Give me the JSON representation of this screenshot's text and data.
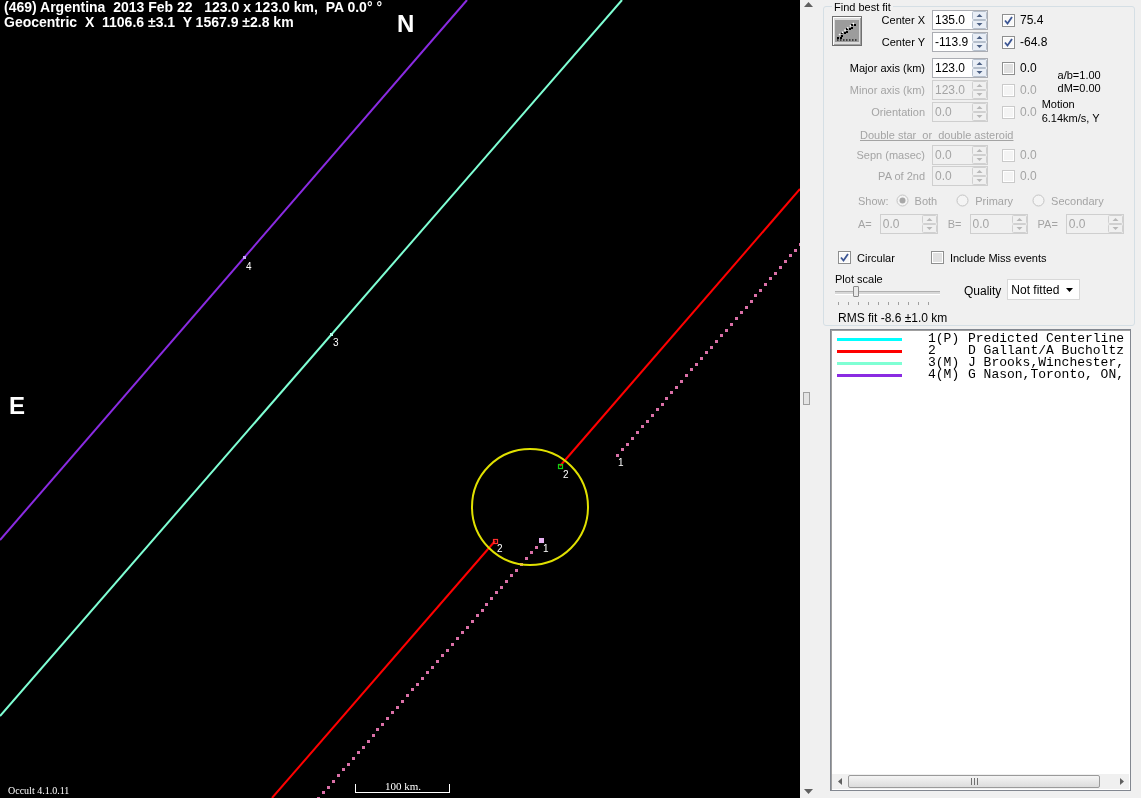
{
  "plot": {
    "title": "(469) Argentina  2013 Feb 22   123.0 x 123.0 km,  PA 0.0° °",
    "subtitle": "Geocentric  X  1106.6 ±3.1  Y 1567.9 ±2.8 km",
    "north": "N",
    "east": "E",
    "version": "Occult 4.1.0.11",
    "scale_bar": "100 km.",
    "chords": [
      {
        "color": "#8a2be2",
        "kind": "solid",
        "labels": [
          "4"
        ]
      },
      {
        "color": "#7fffd4",
        "kind": "solid",
        "labels": [
          "3"
        ]
      },
      {
        "color": "#ff0000",
        "kind": "solid",
        "labels": [
          "2",
          "2"
        ]
      },
      {
        "color": "#db70a8",
        "kind": "dotted",
        "labels": [
          "1",
          "1"
        ]
      }
    ]
  },
  "fit_panel": {
    "title": "Find best fit",
    "params": [
      {
        "label": "Center X",
        "value": "135.0",
        "checked": true,
        "result": "75.4",
        "disabled": false
      },
      {
        "label": "Center Y",
        "value": "-113.9",
        "checked": true,
        "result": "-64.8",
        "disabled": false
      },
      {
        "label": "Major axis (km)",
        "value": "123.0",
        "checked": false,
        "result": "0.0",
        "disabled": false
      },
      {
        "label": "Minor axis (km)",
        "value": "123.0",
        "checked": false,
        "result": "0.0",
        "disabled": true
      },
      {
        "label": "Orientation",
        "value": "0.0",
        "checked": false,
        "result": "0.0",
        "disabled": true
      }
    ],
    "ratio": "a/b=1.00",
    "dm": "dM=0.00",
    "motion_label": "Motion",
    "motion_value": "6.14km/s, Y",
    "double_star": {
      "label": "Double star  or  double asteroid",
      "disabled": true
    },
    "double_params": [
      {
        "label": "Sepn (masec)",
        "value": "0.0",
        "checked": false,
        "result": "0.0",
        "disabled": true
      },
      {
        "label": "PA of 2nd",
        "value": "0.0",
        "checked": false,
        "result": "0.0",
        "disabled": true
      }
    ],
    "show": {
      "label": "Show:",
      "disabled": true,
      "options": [
        {
          "label": "Both",
          "selected": true
        },
        {
          "label": "Primary",
          "selected": false
        },
        {
          "label": "Secondary",
          "selected": false
        }
      ]
    },
    "secondary_fields": [
      {
        "label": "A=",
        "value": "0.0",
        "disabled": true
      },
      {
        "label": "B=",
        "value": "0.0",
        "disabled": true
      },
      {
        "label": "PA=",
        "value": "0.0",
        "disabled": true
      }
    ],
    "circular": {
      "label": "Circular",
      "checked": true
    },
    "include_miss": {
      "label": "Include Miss events",
      "checked": false
    },
    "plot_scale": {
      "label": "Plot scale",
      "level": 0.2
    },
    "quality": {
      "label": "Quality",
      "value": "Not fitted"
    },
    "rms": "RMS fit -8.6 ±1.0 km"
  },
  "legend": {
    "rows": [
      {
        "color": "#00ffff",
        "number": "1(P)",
        "name": "Predicted Centerline"
      },
      {
        "color": "#ff0000",
        "number": "2",
        "name": "D Gallant/A Bucholtz"
      },
      {
        "color": "#7fffd4",
        "number": "3(M)",
        "name": "J Brooks,Winchester,"
      },
      {
        "color": "#8a2be2",
        "number": "4(M)",
        "name": "G Nason,Toronto, ON,"
      }
    ]
  }
}
